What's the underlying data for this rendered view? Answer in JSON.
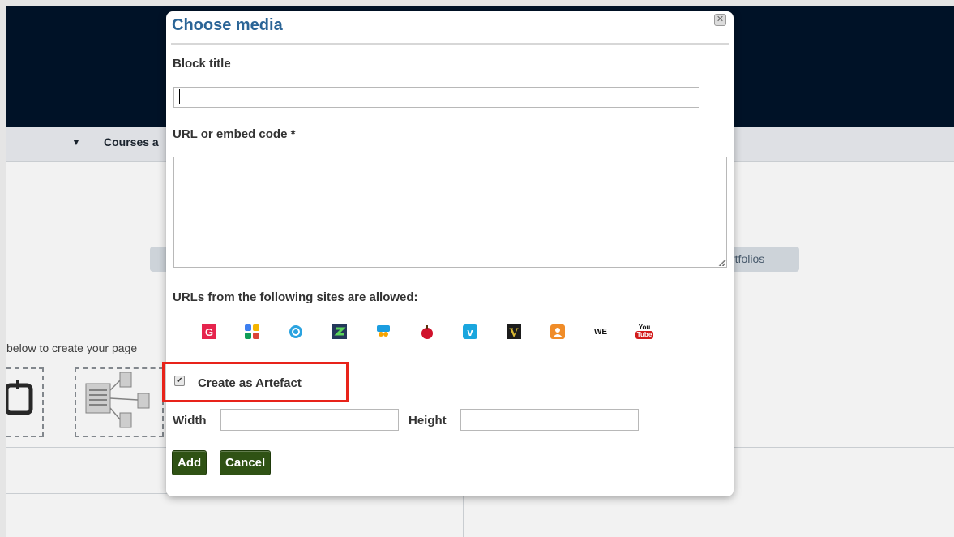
{
  "background": {
    "nav_courses_label": "Courses a",
    "right_pill_label": "rtfolios",
    "instructions_text": "below to create your page"
  },
  "dialog": {
    "title": "Choose media",
    "close_glyph": "✕",
    "block_title_label": "Block title",
    "block_title_value": "",
    "url_label": "URL or embed code *",
    "url_value": "",
    "allowed_sites_label": "URLs from the following sites are allowed:",
    "sites": [
      {
        "name": "google-icon"
      },
      {
        "name": "google-apps-icon"
      },
      {
        "name": "prezi-icon"
      },
      {
        "name": "scivee-icon"
      },
      {
        "name": "slideshare-icon"
      },
      {
        "name": "teachertube-icon"
      },
      {
        "name": "vimeo-icon"
      },
      {
        "name": "voki-icon"
      },
      {
        "name": "voicethread-icon"
      },
      {
        "name": "wikieducator-icon",
        "text": "WE"
      },
      {
        "name": "youtube-icon",
        "text_top": "You",
        "text_bottom": "Tube"
      }
    ],
    "create_artefact_label": "Create as Artefact",
    "create_artefact_checked": true,
    "width_label": "Width",
    "width_value": "",
    "height_label": "Height",
    "height_value": "",
    "add_button": "Add",
    "cancel_button": "Cancel"
  },
  "colors": {
    "header": "#00142a",
    "title": "#2a6496",
    "button": "#2f5214",
    "highlight": "#e8231a"
  }
}
